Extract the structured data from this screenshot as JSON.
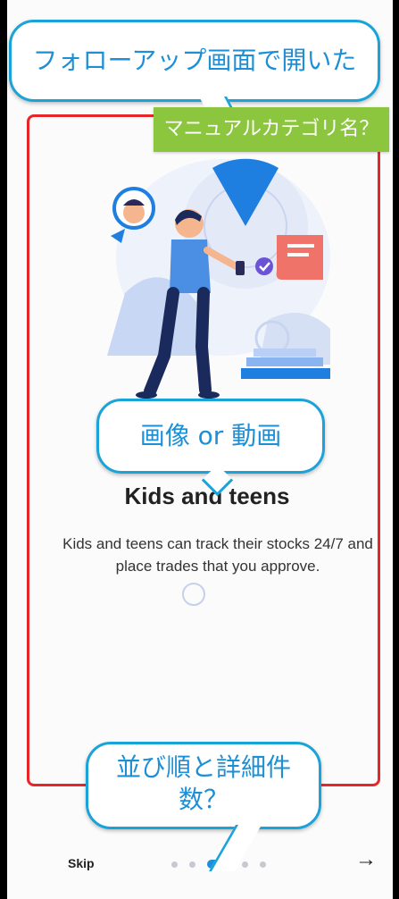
{
  "annotations": {
    "top_callout": "フォローアップ画面で開いた",
    "green_callout": "マニュアルカテゴリ名？",
    "media_callout": "画像 or 動画",
    "order_callout_line1": "並び順と詳細件",
    "order_callout_line2": "数？"
  },
  "slide": {
    "title": "Kids and teens",
    "description": "Kids and teens can track their stocks 24/7 and place trades that you approve."
  },
  "footer": {
    "skip_label": "Skip",
    "next_icon": "→",
    "page_count": 5,
    "active_page": 3
  },
  "colors": {
    "highlight": "#e8262a",
    "callout_border": "#1aa3d9",
    "green_label": "#8cc63f",
    "active_dot": "#1e8fdb"
  }
}
